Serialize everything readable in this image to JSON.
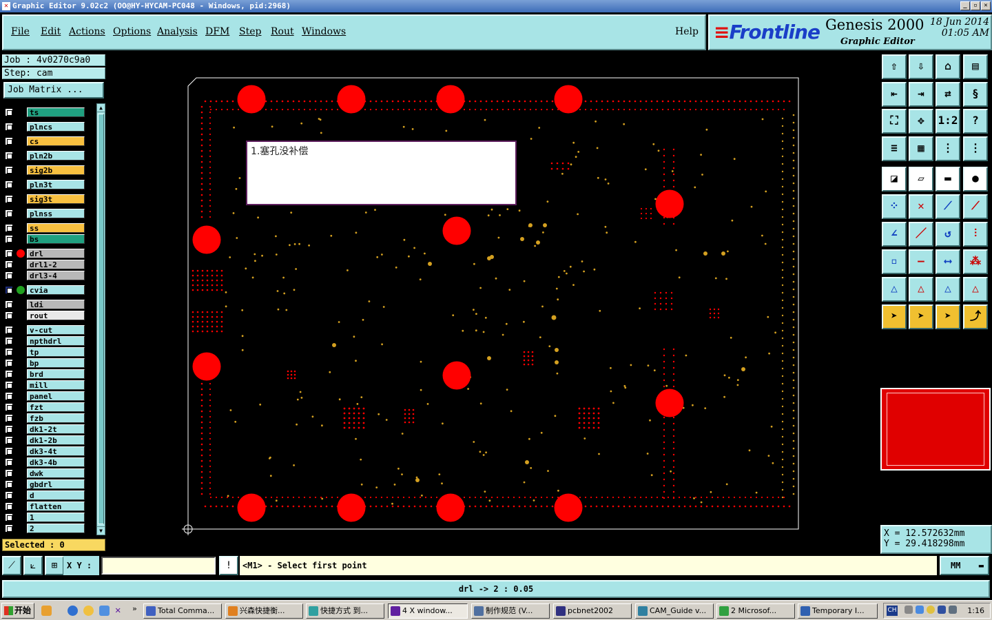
{
  "window": {
    "title": "Graphic Editor 9.02c2 (OO@HY-HYCAM-PC048 - Windows, pid:2968)",
    "buttons": [
      "minimize",
      "restore",
      "close"
    ]
  },
  "menu": {
    "items": [
      "File",
      "Edit",
      "Actions",
      "Options",
      "Analysis",
      "DFM",
      "Step",
      "Rout",
      "Windows"
    ],
    "help": "Help"
  },
  "brand": {
    "logo": "Frontline",
    "product": "Genesis 2000",
    "subtitle": "Graphic Editor",
    "date": "18 Jun 2014",
    "time": "01:05 AM"
  },
  "job": {
    "job_label": "Job : 4v0270c9a0",
    "step_label": "Step: cam",
    "matrix_button": "Job Matrix ..."
  },
  "layers": [
    {
      "name": "ts",
      "color": "#20a080"
    },
    {
      "name": "plncs",
      "color": "#a8e4e6"
    },
    {
      "name": "cs",
      "color": "#f8c040"
    },
    {
      "name": "pln2b",
      "color": "#a8e4e6"
    },
    {
      "name": "sig2b",
      "color": "#f8c040"
    },
    {
      "name": "pln3t",
      "color": "#a8e4e6"
    },
    {
      "name": "sig3t",
      "color": "#f8c040"
    },
    {
      "name": "plnss",
      "color": "#a8e4e6"
    },
    {
      "name": "ss",
      "color": "#f8c040"
    },
    {
      "name": "bs",
      "color": "#20a080"
    },
    {
      "name": "drl",
      "color": "#b8b8b8",
      "dot": "#ff0000"
    },
    {
      "name": "drl1-2",
      "color": "#b8b8b8"
    },
    {
      "name": "drl3-4",
      "color": "#b8b8b8"
    },
    {
      "name": "cvia",
      "color": "#a8e4e6",
      "dot": "#20a020",
      "affected": true
    },
    {
      "name": "ldi",
      "color": "#b8b8b8"
    },
    {
      "name": "rout",
      "color": "#e8e8e8"
    },
    {
      "name": "v-cut",
      "color": "#a8e4e6"
    },
    {
      "name": "npthdrl",
      "color": "#a8e4e6"
    },
    {
      "name": "tp",
      "color": "#a8e4e6"
    },
    {
      "name": "bp",
      "color": "#a8e4e6"
    },
    {
      "name": "brd",
      "color": "#a8e4e6"
    },
    {
      "name": "mill",
      "color": "#a8e4e6"
    },
    {
      "name": "panel",
      "color": "#a8e4e6"
    },
    {
      "name": "fzt",
      "color": "#a8e4e6"
    },
    {
      "name": "fzb",
      "color": "#a8e4e6"
    },
    {
      "name": "dk1-2t",
      "color": "#a8e4e6"
    },
    {
      "name": "dk1-2b",
      "color": "#a8e4e6"
    },
    {
      "name": "dk3-4t",
      "color": "#a8e4e6"
    },
    {
      "name": "dk3-4b",
      "color": "#a8e4e6"
    },
    {
      "name": "dwk",
      "color": "#a8e4e6"
    },
    {
      "name": "gbdrl",
      "color": "#a8e4e6"
    },
    {
      "name": "d",
      "color": "#a8e4e6"
    },
    {
      "name": "flatten",
      "color": "#a8e4e6"
    },
    {
      "name": "1",
      "color": "#a8e4e6"
    },
    {
      "name": "2",
      "color": "#a8e4e6"
    }
  ],
  "selected": "Selected : 0",
  "canvas": {
    "note": "1.塞孔没补偿"
  },
  "coords": {
    "x": "X  =  12.572632mm",
    "y": "Y  =  29.418298mm"
  },
  "command": {
    "xy_label": "X Y :",
    "xy_value": "",
    "prompt": "<M1> - Select first point",
    "units": "MM"
  },
  "status": "drl -> 2 : 0.05",
  "taskbar": {
    "start": "开始",
    "tasks": [
      "Total Comma...",
      "兴森快捷衡...",
      "快捷方式 到...",
      "4 X window...",
      "制作规范 (V...",
      "pcbnet2002",
      "CAM_Guide v...",
      "2 Microsof...",
      "Temporary I..."
    ],
    "lang": "CH",
    "clock": "1:16"
  },
  "colors": {
    "panel_bg": "#a8e4e6",
    "pad_red": "#ff0000",
    "via_gold": "#d4a020"
  }
}
